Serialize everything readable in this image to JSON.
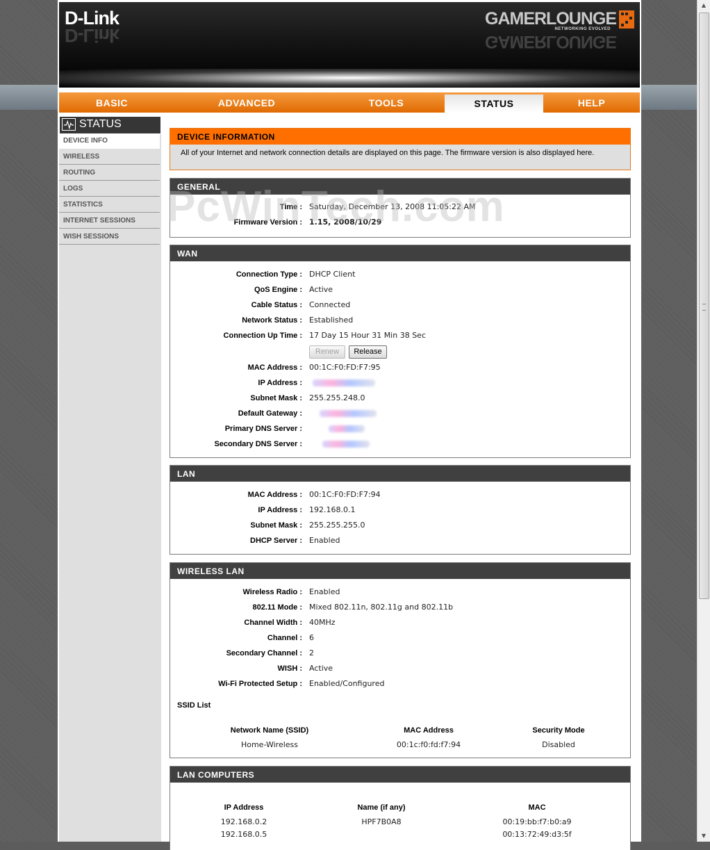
{
  "brand": {
    "logo": "D-Link",
    "product_logo": "GAMERLOUNGE",
    "product_tagline": "NETWORKING EVOLVED"
  },
  "nav": {
    "tabs": [
      "BASIC",
      "ADVANCED",
      "TOOLS",
      "STATUS",
      "HELP"
    ],
    "active": "STATUS"
  },
  "sidebar": {
    "title": "STATUS",
    "icon": "status-monitor-icon",
    "items": [
      "DEVICE INFO",
      "WIRELESS",
      "ROUTING",
      "LOGS",
      "STATISTICS",
      "INTERNET SESSIONS",
      "WISH SESSIONS"
    ],
    "active": "DEVICE INFO"
  },
  "device_info": {
    "title": "DEVICE INFORMATION",
    "description": "All of your Internet and network connection details are displayed on this page. The firmware version is also displayed here."
  },
  "general": {
    "title": "GENERAL",
    "time_label": "Time :",
    "time_value": "Saturday, December 13, 2008 11:05:22 AM",
    "firmware_label": "Firmware Version :",
    "firmware_value": "1.15,  2008/10/29"
  },
  "wan": {
    "title": "WAN",
    "connection_type_label": "Connection Type :",
    "connection_type": "DHCP Client",
    "qos_label": "QoS Engine :",
    "qos": "Active",
    "cable_label": "Cable Status :",
    "cable": "Connected",
    "network_label": "Network Status :",
    "network": "Established",
    "uptime_label": "Connection Up Time :",
    "uptime": "17 Day 15 Hour 31 Min 38 Sec",
    "renew_label": "Renew",
    "release_label": "Release",
    "mac_label": "MAC Address :",
    "mac": "00:1C:F0:FD:F7:95",
    "ip_label": "IP Address :",
    "subnet_label": "Subnet Mask :",
    "subnet": "255.255.248.0",
    "gateway_label": "Default Gateway :",
    "primary_dns_label": "Primary DNS Server :",
    "secondary_dns_label": "Secondary DNS Server :"
  },
  "lan": {
    "title": "LAN",
    "mac_label": "MAC Address :",
    "mac": "00:1C:F0:FD:F7:94",
    "ip_label": "IP Address :",
    "ip": "192.168.0.1",
    "subnet_label": "Subnet Mask :",
    "subnet": "255.255.255.0",
    "dhcp_label": "DHCP Server :",
    "dhcp": "Enabled"
  },
  "wireless_lan": {
    "title": "WIRELESS LAN",
    "radio_label": "Wireless Radio :",
    "radio": "Enabled",
    "mode_label": "802.11 Mode :",
    "mode": "Mixed 802.11n, 802.11g and 802.11b",
    "width_label": "Channel Width :",
    "width": "40MHz",
    "channel_label": "Channel :",
    "channel": "6",
    "secondary_label": "Secondary Channel :",
    "secondary": "2",
    "wish_label": "WISH :",
    "wish": "Active",
    "wps_label": "Wi-Fi Protected Setup :",
    "wps": "Enabled/Configured",
    "ssid_list_label": "SSID List",
    "ssid_headers": [
      "Network Name (SSID)",
      "MAC Address",
      "Security Mode"
    ],
    "ssid_rows": [
      [
        "Home-Wireless",
        "00:1c:f0:fd:f7:94",
        "Disabled"
      ]
    ]
  },
  "lan_computers": {
    "title": "LAN COMPUTERS",
    "headers": [
      "IP Address",
      "Name (if any)",
      "MAC"
    ],
    "rows": [
      [
        "192.168.0.2",
        "HPF7B0A8",
        "00:19:bb:f7:b0:a9"
      ],
      [
        "192.168.0.5",
        "",
        "00:13:72:49:d3:5f"
      ]
    ]
  },
  "watermark": "PcWinTech.com"
}
